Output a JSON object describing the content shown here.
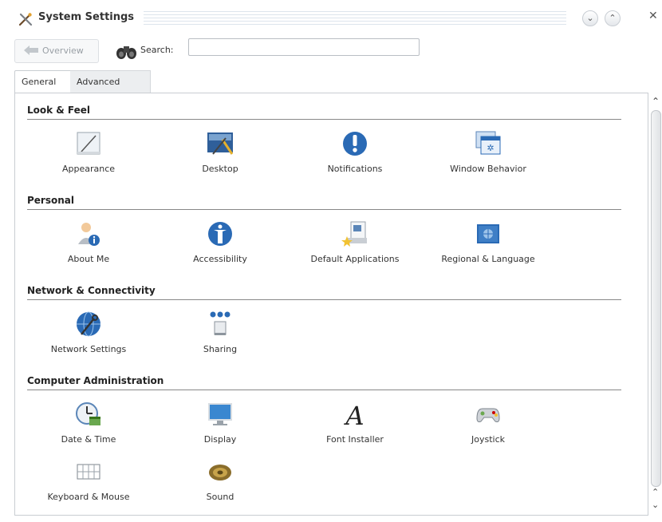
{
  "window": {
    "title": "System Settings",
    "minimize_glyph": "⌄",
    "maximize_glyph": "⌃",
    "close_glyph": "✕"
  },
  "toolbar": {
    "overview_label": "Overview",
    "search_label": "Search:",
    "search_value": ""
  },
  "tabs": [
    {
      "label": "General",
      "active": true
    },
    {
      "label": "Advanced",
      "active": false
    }
  ],
  "sections": [
    {
      "title": "Look & Feel",
      "items": [
        {
          "label": "Appearance",
          "icon": "appearance-icon"
        },
        {
          "label": "Desktop",
          "icon": "desktop-icon"
        },
        {
          "label": "Notifications",
          "icon": "notifications-icon"
        },
        {
          "label": "Window Behavior",
          "icon": "window-behavior-icon"
        }
      ]
    },
    {
      "title": "Personal",
      "items": [
        {
          "label": "About Me",
          "icon": "about-me-icon"
        },
        {
          "label": "Accessibility",
          "icon": "accessibility-icon"
        },
        {
          "label": "Default Applications",
          "icon": "default-applications-icon"
        },
        {
          "label": "Regional & Language",
          "icon": "regional-language-icon"
        }
      ]
    },
    {
      "title": "Network & Connectivity",
      "items": [
        {
          "label": "Network Settings",
          "icon": "network-settings-icon"
        },
        {
          "label": "Sharing",
          "icon": "sharing-icon"
        }
      ]
    },
    {
      "title": "Computer Administration",
      "items": [
        {
          "label": "Date & Time",
          "icon": "date-time-icon"
        },
        {
          "label": "Display",
          "icon": "display-icon"
        },
        {
          "label": "Font Installer",
          "icon": "font-installer-icon"
        },
        {
          "label": "Joystick",
          "icon": "joystick-icon"
        },
        {
          "label": "Keyboard & Mouse",
          "icon": "keyboard-mouse-icon"
        },
        {
          "label": "Sound",
          "icon": "sound-icon"
        }
      ]
    }
  ],
  "colors": {
    "accent_blue": "#2a6ab5",
    "panel_border": "#c9cdd2"
  }
}
